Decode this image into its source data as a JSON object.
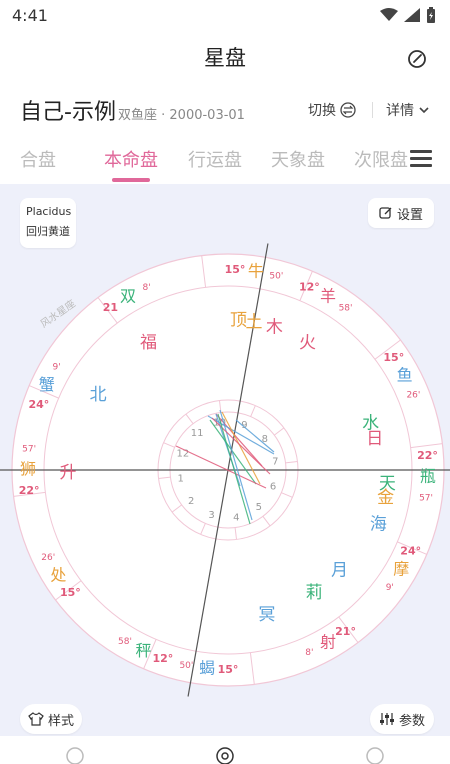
{
  "status_bar": {
    "time": "4:41"
  },
  "header": {
    "title": "星盘"
  },
  "profile": {
    "name": "自己-示例",
    "sign_date": "双鱼座 · 2000-03-01",
    "switch_label": "切换",
    "detail_label": "详情"
  },
  "tabs": [
    {
      "label": "合盘"
    },
    {
      "label": "本命盘"
    },
    {
      "label": "行运盘"
    },
    {
      "label": "天象盘"
    },
    {
      "label": "次限盘"
    }
  ],
  "active_tab": "本命盘",
  "chart_options": {
    "house_system": "Placidus",
    "zodiac": "回归黄道",
    "settings_label": "设置"
  },
  "footer_buttons": {
    "style_label": "样式",
    "params_label": "参数"
  },
  "wheel": {
    "mode_label": "风水星座",
    "signs": [
      {
        "glyph": "牛",
        "deg": "15°",
        "min": "50'",
        "color": "#e8a23c"
      },
      {
        "glyph": "双",
        "deg": "21",
        "min": "8'",
        "color": "#3bb37a"
      },
      {
        "glyph": "蟹",
        "deg": "24°",
        "min": "9'",
        "color": "#5aa0d8"
      },
      {
        "glyph": "狮",
        "deg": "22°",
        "min": "57'",
        "color": "#e8a23c"
      },
      {
        "glyph": "处",
        "deg": "15°",
        "min": "26'",
        "color": "#e8a23c"
      },
      {
        "glyph": "秤",
        "deg": "12°",
        "min": "58'",
        "color": "#3bb37a"
      },
      {
        "glyph": "蝎",
        "deg": "15°",
        "min": "50'",
        "color": "#5aa0d8"
      },
      {
        "glyph": "射",
        "deg": "21°",
        "min": "8'",
        "color": "#e05a7a"
      },
      {
        "glyph": "摩",
        "deg": "24°",
        "min": "9'",
        "color": "#e8a23c"
      },
      {
        "glyph": "瓶",
        "deg": "22°",
        "min": "57'",
        "color": "#3bb37a"
      },
      {
        "glyph": "鱼",
        "deg": "15°",
        "min": "26'",
        "color": "#5aa0d8"
      },
      {
        "glyph": "羊",
        "deg": "12°",
        "min": "58'",
        "color": "#e05a7a"
      }
    ],
    "planets": [
      {
        "glyph": "顶",
        "color": "#e8a23c"
      },
      {
        "glyph": "土",
        "color": "#e8a23c"
      },
      {
        "glyph": "木",
        "color": "#e05a7a"
      },
      {
        "glyph": "火",
        "color": "#e05a7a"
      },
      {
        "glyph": "福",
        "color": "#e05a7a"
      },
      {
        "glyph": "北",
        "color": "#5aa0d8"
      },
      {
        "glyph": "升",
        "color": "#e05a7a"
      },
      {
        "glyph": "水",
        "color": "#3bb37a"
      },
      {
        "glyph": "日",
        "color": "#e05a7a"
      },
      {
        "glyph": "天",
        "color": "#3bb37a"
      },
      {
        "glyph": "金",
        "color": "#e8a23c"
      },
      {
        "glyph": "海",
        "color": "#5aa0d8"
      },
      {
        "glyph": "月",
        "color": "#5aa0d8"
      },
      {
        "glyph": "莉",
        "color": "#3bb37a"
      },
      {
        "glyph": "冥",
        "color": "#5aa0d8"
      }
    ],
    "house_numbers": [
      "1",
      "2",
      "3",
      "4",
      "5",
      "6",
      "7",
      "8",
      "9",
      "10",
      "11",
      "12"
    ]
  }
}
